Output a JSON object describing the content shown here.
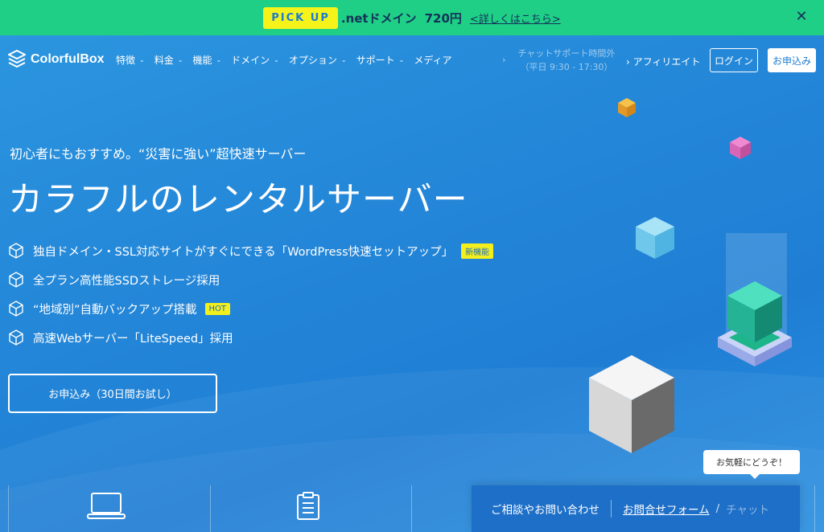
{
  "promo": {
    "badge": "PICK UP",
    "text": ".netドメイン",
    "price": "720円",
    "link": "<詳しくはこちら>",
    "close_icon": "close-icon"
  },
  "header": {
    "logo_text": "ColorfulBox",
    "nav": [
      {
        "label": "特徴"
      },
      {
        "label": "料金"
      },
      {
        "label": "機能"
      },
      {
        "label": "ドメイン"
      },
      {
        "label": "オプション"
      },
      {
        "label": "サポート"
      },
      {
        "label": "メディア"
      }
    ],
    "support_line1": "チャットサポート時間外",
    "support_line2": "（平日 9:30 - 17:30）",
    "affiliate": "アフィリエイト",
    "login": "ログイン",
    "signup": "お申込み"
  },
  "hero": {
    "subtitle": "初心者にもおすすめ。“災害に強い”超快速サーバー",
    "title": "カラフルのレンタルサーバー",
    "features": [
      {
        "text": "独自ドメイン・SSL対応サイトがすぐにできる「WordPress快速セットアップ」",
        "badge": "新機能"
      },
      {
        "text": "全プラン高性能SSDストレージ採用",
        "badge": ""
      },
      {
        "text": "“地域別”自動バックアップ搭載",
        "badge": "HOT"
      },
      {
        "text": "高速Webサーバー「LiteSpeed」採用",
        "badge": ""
      }
    ],
    "cta": "お申込み（30日間お試し）"
  },
  "chat": {
    "tooltip": "お気軽にどうぞ！",
    "label": "ご相談やお問い合わせ",
    "form_link": "お問合せフォーム",
    "slash": "/",
    "chat_link": "チャット"
  },
  "colors": {
    "promo_bg": "#1fcf86",
    "badge_yellow": "#f6f31a",
    "hero_blue": "#2487d8"
  }
}
